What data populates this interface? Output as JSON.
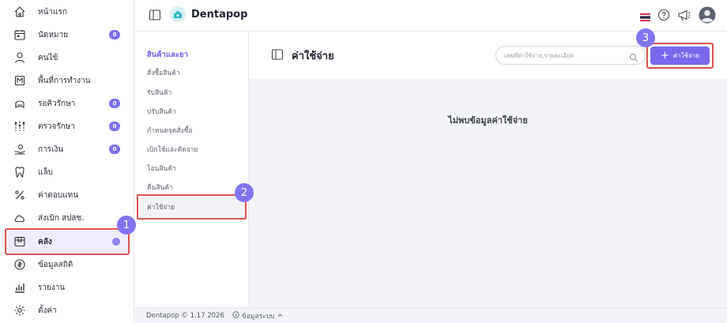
{
  "sidebar": {
    "items": [
      {
        "label": "หน้าแรก",
        "icon": "home-icon"
      },
      {
        "label": "นัดหมาย",
        "icon": "calendar-icon",
        "badge": "0"
      },
      {
        "label": "คนไข้",
        "icon": "user-icon"
      },
      {
        "label": "พื้นที่การทำงาน",
        "icon": "workspace-icon"
      },
      {
        "label": "รอคิวรักษา",
        "icon": "queue-icon",
        "badge": "0"
      },
      {
        "label": "ตรวจรักษา",
        "icon": "treatment-icon",
        "badge": "0"
      },
      {
        "label": "การเงิน",
        "icon": "payment-icon",
        "badge": "0"
      },
      {
        "label": "แล็บ",
        "icon": "tooth-icon"
      },
      {
        "label": "ค่าตอบแทน",
        "icon": "percent-icon"
      },
      {
        "label": "ส่งเบิก สปสช.",
        "icon": "cloud-icon"
      },
      {
        "label": "คลัง",
        "icon": "inventory-icon",
        "active": true
      },
      {
        "label": "ข้อมูลสถิติ",
        "icon": "statistics-icon"
      },
      {
        "label": "รายงาน",
        "icon": "report-icon"
      },
      {
        "label": "ตั้งค่า",
        "icon": "settings-icon"
      }
    ]
  },
  "topbar": {
    "app_name": "Dentapop"
  },
  "submenu": {
    "heading": "สินค้าและยา",
    "items": [
      "สั่งซื้อสินค้า",
      "รับสินค้า",
      "ปรับสินค้า",
      "กำหนดจุดสั่งซื้อ",
      "เบิกใช้และตัดจ่าย",
      "โอนสินค้า",
      "คืนสินค้า",
      "ค่าใช้จ่าย"
    ],
    "active_index": 7
  },
  "main": {
    "title": "ค่าใช้จ่าย",
    "search_placeholder": "เลขที่ค่าใช้จ่าย,รายละเอียด",
    "add_button_label": "ค่าใช้จ่าย",
    "empty_message": "ไม่พบข้อมูลค่าใช้จ่าย"
  },
  "footer": {
    "version": "Dentapop © 1.17 2026",
    "system_info": "ข้อมูลระบบ"
  },
  "steps": [
    "1",
    "2",
    "3"
  ],
  "colors": {
    "accent": "#7a68ee",
    "highlight": "#d9534f",
    "badge": "#7c6ff0"
  }
}
